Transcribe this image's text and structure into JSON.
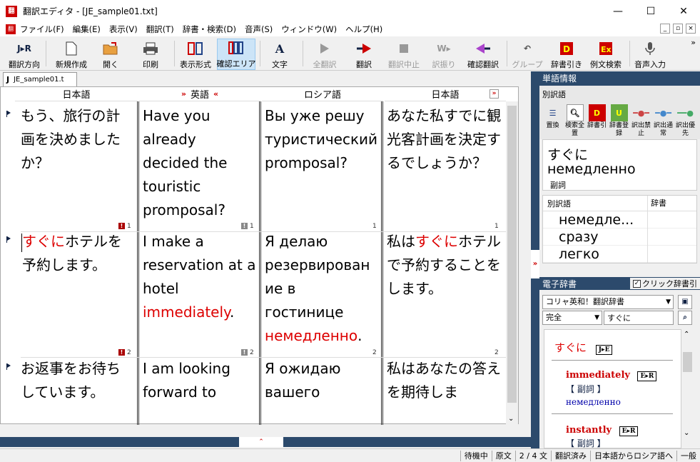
{
  "window": {
    "title": "翻訳エディタ - [JE_sample01.txt]",
    "app_icon": "翻",
    "buttons": [
      "—",
      "☐",
      "✕"
    ]
  },
  "menu": [
    "ファイル(F)",
    "編集(E)",
    "表示(V)",
    "翻訳(T)",
    "辞書・検索(D)",
    "音声(S)",
    "ウィンドウ(W)",
    "ヘルプ(H)"
  ],
  "toolbar": {
    "direction": "翻訳方向",
    "direction_icon": "J▸R",
    "new": "新規作成",
    "open": "開く",
    "print": "印刷",
    "view_format": "表示形式",
    "confirm_area": "確認エリア",
    "font": "文字",
    "translate_all": "全翻訳",
    "translate": "翻訳",
    "stop": "翻訳中止",
    "ruby": "訳振り",
    "confirm_translate": "確認翻訳",
    "group": "グループ",
    "dict_lookup": "辞書引き",
    "example_search": "例文検索",
    "voice_input": "音声入力",
    "more": "»"
  },
  "doc_tab": {
    "icon": "J",
    "label": "JE_sample01.t"
  },
  "columns": [
    "日本語",
    "英語",
    "ロシア語",
    "日本語"
  ],
  "column_arrows": {
    "left": "»",
    "right": "«",
    "last": "»"
  },
  "rows": [
    {
      "ja": "もう、旅行の計画を決めましたか？",
      "en": "Have you already decided the touristic promposal?",
      "ru": "Вы уже решу туристический promposal?",
      "ja2": "あなた私すでに観光客計画を決定するでしょうか？",
      "num": "1"
    },
    {
      "ja_pre": "",
      "ja_hl": "すぐに",
      "ja_post": "ホテルを予約します。",
      "en_pre": "I make a reservation at a hotel ",
      "en_hl": "immediately",
      "en_post": ".",
      "ru_pre": "Я делаю резервирован ие в гостинице ",
      "ru_hl": "немедленно",
      "ru_post": ".",
      "ja2_pre": "私は",
      "ja2_hl": "すぐに",
      "ja2_post": "ホテルで予約することをします。",
      "num": "2"
    },
    {
      "ja": "お返事をお待ちしています。",
      "en": "I am looking forward to",
      "ru": "Я ожидаю вашего",
      "ja2": "私はあなたの答えを期待しま",
      "num": "3"
    }
  ],
  "right_panel": {
    "title": "単語情報",
    "alt_label": "別訳語",
    "tools": [
      "置換",
      "検索全置",
      "辞書引",
      "辞書登録",
      "訳出禁止",
      "訳出通常",
      "訳出優先"
    ],
    "word_ja": "すぐに",
    "word_ru": "немедленно",
    "word_pos": "副詞",
    "alt_header": "別訳語",
    "dict_header": "辞書",
    "alternatives": [
      "немедле...",
      "сразу",
      "легко"
    ]
  },
  "e_dict": {
    "title": "電子辞書",
    "click_lookup": "クリック辞書引",
    "dictionary": "コリャ英和！翻訳辞書",
    "scope": "完全",
    "query": "すぐに",
    "headword": "すぐに",
    "headword_tag": "J▸E",
    "entries": [
      {
        "en": "immediately",
        "tag": "E▸R",
        "pos": "【 副詞 】",
        "tr": "немедленно"
      },
      {
        "en": "instantly",
        "tag": "E▸R",
        "pos": "【 副詞 】"
      }
    ]
  },
  "status": [
    "待機中",
    "原文",
    "2 / 4 文",
    "翻訳済み",
    "日本語からロシア語へ",
    "一般"
  ]
}
